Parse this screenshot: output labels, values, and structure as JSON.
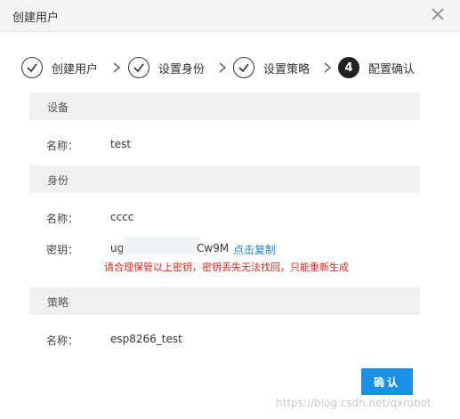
{
  "dialog": {
    "title": "创建用户"
  },
  "steps": [
    {
      "label": "创建用户",
      "state": "done"
    },
    {
      "label": "设置身份",
      "state": "done"
    },
    {
      "label": "设置策略",
      "state": "done"
    },
    {
      "label": "配置确认",
      "state": "active",
      "number": "4"
    }
  ],
  "device": {
    "section_title": "设备",
    "name_label": "名称：",
    "name_value": "test"
  },
  "identity": {
    "section_title": "身份",
    "name_label": "名称：",
    "name_value": "cccc",
    "secret_label": "密钥：",
    "secret_prefix": "ug",
    "secret_suffix": "Cw9M",
    "copy_link": "点击复制",
    "warning": "请合理保管以上密钥，密钥丢失无法找回，只能重新生成"
  },
  "policy": {
    "section_title": "策略",
    "name_label": "名称：",
    "name_value": "esp8266_test"
  },
  "footer": {
    "confirm_label": "确认"
  },
  "watermark": "https://blog.csdn.net/qxrobot"
}
